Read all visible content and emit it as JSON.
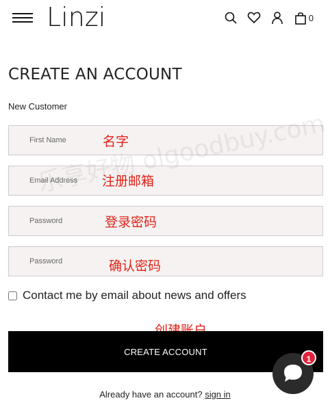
{
  "header": {
    "logo": "Linzi",
    "cart_count": "0",
    "icons": [
      "menu-icon",
      "search-icon",
      "heart-icon",
      "user-icon",
      "bag-icon"
    ]
  },
  "page": {
    "title": "CREATE AN ACCOUNT",
    "subtitle": "New Customer"
  },
  "form": {
    "first_name_placeholder": "First Name",
    "email_placeholder": "Email Address",
    "password_placeholder": "Password",
    "confirm_password_placeholder": "Password",
    "newsletter_label": "Contact me by email about news and offers",
    "submit_label": "CREATE ACCOUNT"
  },
  "annotations": {
    "first_name": "名字",
    "email": "注册邮箱",
    "password": "登录密码",
    "confirm_password": "确认密码",
    "create_account": "创建账户"
  },
  "footer": {
    "prompt": "Already have an account?",
    "signin_link": "sign in"
  },
  "chat": {
    "badge": "1"
  },
  "watermark": "乐享好物 olgoodbuy.com",
  "colors": {
    "accent_red": "#e0231a",
    "field_bg": "#f6f2f1",
    "button_bg": "#000000",
    "badge": "#e0233f"
  }
}
